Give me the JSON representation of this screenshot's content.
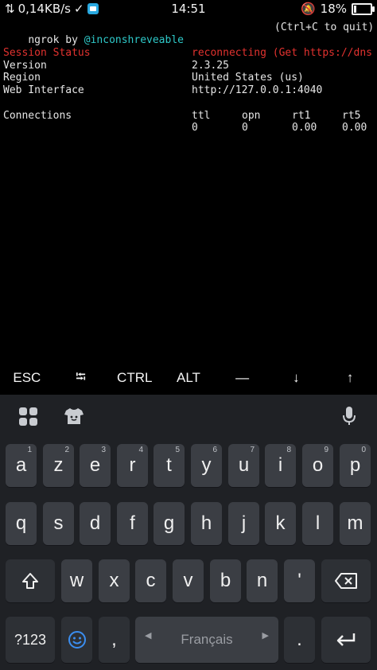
{
  "status_bar": {
    "speed": "0,14KB/s",
    "time": "14:51",
    "battery": "18%",
    "battery_level": 0.18
  },
  "terminal": {
    "header_left_prefix": "ngrok by ",
    "header_left_handle": "@inconshreveable",
    "header_right": "(Ctrl+C to quit)",
    "rows": [
      {
        "label": "Session Status",
        "value": "reconnecting (Get https://dns"
      },
      {
        "label": "Version",
        "value": "2.3.25"
      },
      {
        "label": "Region",
        "value": "United States (us)"
      },
      {
        "label": "Web Interface",
        "value": "http://127.0.0.1:4040"
      }
    ],
    "connections": {
      "label": "Connections",
      "headers": [
        "ttl",
        "opn",
        "rt1",
        "rt5"
      ],
      "values": [
        "0",
        "0",
        "0.00",
        "0.00"
      ]
    }
  },
  "extra_keys": [
    "ESC",
    "⭾",
    "CTRL",
    "ALT",
    "—",
    "↓",
    "↑"
  ],
  "keyboard": {
    "row1": [
      {
        "k": "a",
        "h": "1"
      },
      {
        "k": "z",
        "h": "2"
      },
      {
        "k": "e",
        "h": "3"
      },
      {
        "k": "r",
        "h": "4"
      },
      {
        "k": "t",
        "h": "5"
      },
      {
        "k": "y",
        "h": "6"
      },
      {
        "k": "u",
        "h": "7"
      },
      {
        "k": "i",
        "h": "8"
      },
      {
        "k": "o",
        "h": "9"
      },
      {
        "k": "p",
        "h": "0"
      }
    ],
    "row2": [
      "q",
      "s",
      "d",
      "f",
      "g",
      "h",
      "j",
      "k",
      "l",
      "m"
    ],
    "row3": [
      "w",
      "x",
      "c",
      "v",
      "b",
      "n",
      "'"
    ],
    "symbols_label": "?123",
    "comma": ",",
    "space_label": "Français",
    "period": "."
  }
}
